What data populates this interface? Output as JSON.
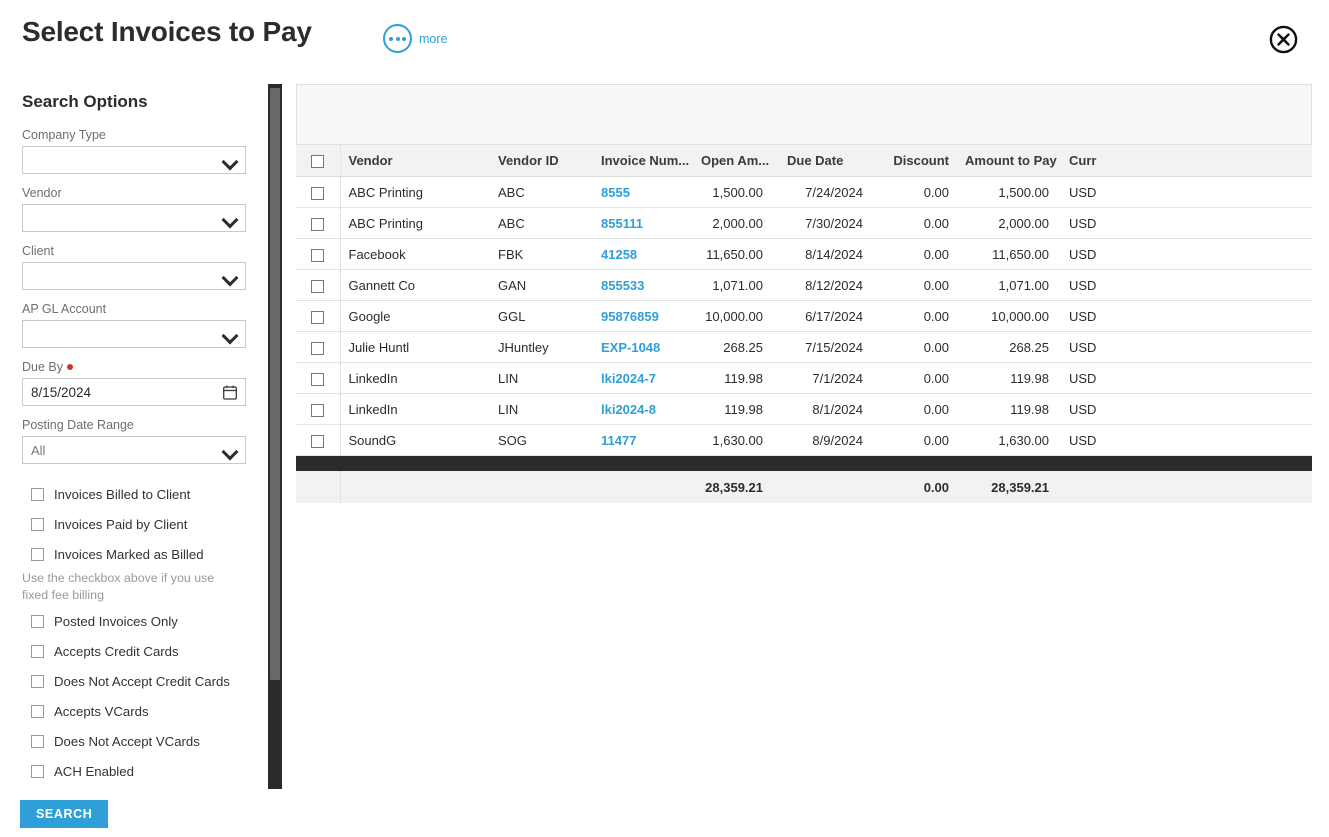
{
  "header": {
    "title": "Select Invoices to Pay",
    "more_label": "more",
    "more_icon": "ellipsis-circle-icon",
    "close_icon": "close-circle-icon",
    "accent_color": "#2f9fd8"
  },
  "sidebar": {
    "title": "Search Options",
    "fields": [
      {
        "label": "Company Type",
        "value": "",
        "type": "select"
      },
      {
        "label": "Vendor",
        "value": "",
        "type": "select"
      },
      {
        "label": "Client",
        "value": "",
        "type": "select"
      },
      {
        "label": "AP GL Account",
        "value": "",
        "type": "select"
      }
    ],
    "due_by": {
      "label": "Due By",
      "value": "8/15/2024",
      "required": true,
      "icon": "calendar-icon"
    },
    "posting_date_range": {
      "label": "Posting Date Range",
      "value": "All"
    },
    "checkboxes_group_1": [
      {
        "label": "Invoices Billed to Client",
        "checked": false
      },
      {
        "label": "Invoices Paid by Client",
        "checked": false
      },
      {
        "label": "Invoices Marked as Billed",
        "checked": false
      }
    ],
    "help_text": "Use the checkbox above if you use fixed fee billing",
    "checkboxes_group_2": [
      {
        "label": "Posted Invoices Only",
        "checked": false
      },
      {
        "label": "Accepts Credit Cards",
        "checked": false
      },
      {
        "label": "Does Not Accept Credit Cards",
        "checked": false
      },
      {
        "label": "Accepts VCards",
        "checked": false
      },
      {
        "label": "Does Not Accept VCards",
        "checked": false
      },
      {
        "label": "ACH Enabled",
        "checked": false
      }
    ],
    "search_button": "SEARCH"
  },
  "table": {
    "columns": [
      "",
      "Vendor",
      "Vendor ID",
      "Invoice Num...",
      "Open Am...",
      "Due Date",
      "Discount",
      "Amount to Pay",
      "Curr"
    ],
    "rows": [
      {
        "checked": false,
        "vendor": "ABC Printing",
        "vendor_id": "ABC",
        "invoice_number": "8555",
        "open_amount": "1,500.00",
        "due_date": "7/24/2024",
        "discount": "0.00",
        "amount_to_pay": "1,500.00",
        "currency": "USD"
      },
      {
        "checked": false,
        "vendor": "ABC Printing",
        "vendor_id": "ABC",
        "invoice_number": "855111",
        "open_amount": "2,000.00",
        "due_date": "7/30/2024",
        "discount": "0.00",
        "amount_to_pay": "2,000.00",
        "currency": "USD"
      },
      {
        "checked": false,
        "vendor": "Facebook",
        "vendor_id": "FBK",
        "invoice_number": "41258",
        "open_amount": "11,650.00",
        "due_date": "8/14/2024",
        "discount": "0.00",
        "amount_to_pay": "11,650.00",
        "currency": "USD"
      },
      {
        "checked": false,
        "vendor": "Gannett Co",
        "vendor_id": "GAN",
        "invoice_number": "855533",
        "open_amount": "1,071.00",
        "due_date": "8/12/2024",
        "discount": "0.00",
        "amount_to_pay": "1,071.00",
        "currency": "USD"
      },
      {
        "checked": false,
        "vendor": "Google",
        "vendor_id": "GGL",
        "invoice_number": "95876859",
        "open_amount": "10,000.00",
        "due_date": "6/17/2024",
        "discount": "0.00",
        "amount_to_pay": "10,000.00",
        "currency": "USD"
      },
      {
        "checked": false,
        "vendor": "Julie Huntl",
        "vendor_id": "JHuntley",
        "invoice_number": "EXP-1048",
        "open_amount": "268.25",
        "due_date": "7/15/2024",
        "discount": "0.00",
        "amount_to_pay": "268.25",
        "currency": "USD"
      },
      {
        "checked": false,
        "vendor": "LinkedIn",
        "vendor_id": "LIN",
        "invoice_number": "lki2024-7",
        "open_amount": "119.98",
        "due_date": "7/1/2024",
        "discount": "0.00",
        "amount_to_pay": "119.98",
        "currency": "USD"
      },
      {
        "checked": false,
        "vendor": "LinkedIn",
        "vendor_id": "LIN",
        "invoice_number": "lki2024-8",
        "open_amount": "119.98",
        "due_date": "8/1/2024",
        "discount": "0.00",
        "amount_to_pay": "119.98",
        "currency": "USD"
      },
      {
        "checked": false,
        "vendor": "SoundG",
        "vendor_id": "SOG",
        "invoice_number": "11477",
        "open_amount": "1,630.00",
        "due_date": "8/9/2024",
        "discount": "0.00",
        "amount_to_pay": "1,630.00",
        "currency": "USD"
      }
    ],
    "totals": {
      "open_amount": "28,359.21",
      "discount": "0.00",
      "amount_to_pay": "28,359.21"
    }
  }
}
